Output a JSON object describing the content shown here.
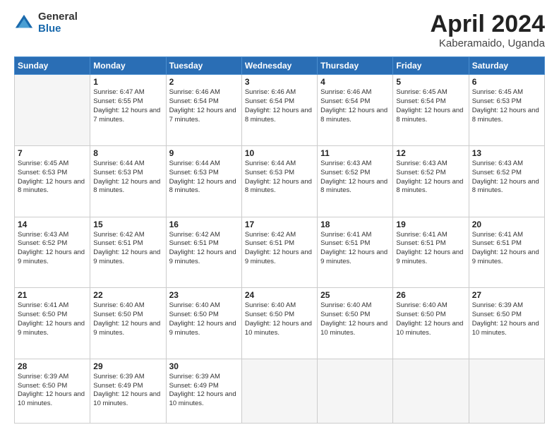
{
  "logo": {
    "general": "General",
    "blue": "Blue"
  },
  "title": {
    "month": "April 2024",
    "location": "Kaberamaido, Uganda"
  },
  "header_days": [
    "Sunday",
    "Monday",
    "Tuesday",
    "Wednesday",
    "Thursday",
    "Friday",
    "Saturday"
  ],
  "weeks": [
    [
      {
        "day": "",
        "sunrise": "",
        "sunset": "",
        "daylight": ""
      },
      {
        "day": "1",
        "sunrise": "Sunrise: 6:47 AM",
        "sunset": "Sunset: 6:55 PM",
        "daylight": "Daylight: 12 hours and 7 minutes."
      },
      {
        "day": "2",
        "sunrise": "Sunrise: 6:46 AM",
        "sunset": "Sunset: 6:54 PM",
        "daylight": "Daylight: 12 hours and 7 minutes."
      },
      {
        "day": "3",
        "sunrise": "Sunrise: 6:46 AM",
        "sunset": "Sunset: 6:54 PM",
        "daylight": "Daylight: 12 hours and 8 minutes."
      },
      {
        "day": "4",
        "sunrise": "Sunrise: 6:46 AM",
        "sunset": "Sunset: 6:54 PM",
        "daylight": "Daylight: 12 hours and 8 minutes."
      },
      {
        "day": "5",
        "sunrise": "Sunrise: 6:45 AM",
        "sunset": "Sunset: 6:54 PM",
        "daylight": "Daylight: 12 hours and 8 minutes."
      },
      {
        "day": "6",
        "sunrise": "Sunrise: 6:45 AM",
        "sunset": "Sunset: 6:53 PM",
        "daylight": "Daylight: 12 hours and 8 minutes."
      }
    ],
    [
      {
        "day": "7",
        "sunrise": "Sunrise: 6:45 AM",
        "sunset": "Sunset: 6:53 PM",
        "daylight": "Daylight: 12 hours and 8 minutes."
      },
      {
        "day": "8",
        "sunrise": "Sunrise: 6:44 AM",
        "sunset": "Sunset: 6:53 PM",
        "daylight": "Daylight: 12 hours and 8 minutes."
      },
      {
        "day": "9",
        "sunrise": "Sunrise: 6:44 AM",
        "sunset": "Sunset: 6:53 PM",
        "daylight": "Daylight: 12 hours and 8 minutes."
      },
      {
        "day": "10",
        "sunrise": "Sunrise: 6:44 AM",
        "sunset": "Sunset: 6:53 PM",
        "daylight": "Daylight: 12 hours and 8 minutes."
      },
      {
        "day": "11",
        "sunrise": "Sunrise: 6:43 AM",
        "sunset": "Sunset: 6:52 PM",
        "daylight": "Daylight: 12 hours and 8 minutes."
      },
      {
        "day": "12",
        "sunrise": "Sunrise: 6:43 AM",
        "sunset": "Sunset: 6:52 PM",
        "daylight": "Daylight: 12 hours and 8 minutes."
      },
      {
        "day": "13",
        "sunrise": "Sunrise: 6:43 AM",
        "sunset": "Sunset: 6:52 PM",
        "daylight": "Daylight: 12 hours and 8 minutes."
      }
    ],
    [
      {
        "day": "14",
        "sunrise": "Sunrise: 6:43 AM",
        "sunset": "Sunset: 6:52 PM",
        "daylight": "Daylight: 12 hours and 9 minutes."
      },
      {
        "day": "15",
        "sunrise": "Sunrise: 6:42 AM",
        "sunset": "Sunset: 6:51 PM",
        "daylight": "Daylight: 12 hours and 9 minutes."
      },
      {
        "day": "16",
        "sunrise": "Sunrise: 6:42 AM",
        "sunset": "Sunset: 6:51 PM",
        "daylight": "Daylight: 12 hours and 9 minutes."
      },
      {
        "day": "17",
        "sunrise": "Sunrise: 6:42 AM",
        "sunset": "Sunset: 6:51 PM",
        "daylight": "Daylight: 12 hours and 9 minutes."
      },
      {
        "day": "18",
        "sunrise": "Sunrise: 6:41 AM",
        "sunset": "Sunset: 6:51 PM",
        "daylight": "Daylight: 12 hours and 9 minutes."
      },
      {
        "day": "19",
        "sunrise": "Sunrise: 6:41 AM",
        "sunset": "Sunset: 6:51 PM",
        "daylight": "Daylight: 12 hours and 9 minutes."
      },
      {
        "day": "20",
        "sunrise": "Sunrise: 6:41 AM",
        "sunset": "Sunset: 6:51 PM",
        "daylight": "Daylight: 12 hours and 9 minutes."
      }
    ],
    [
      {
        "day": "21",
        "sunrise": "Sunrise: 6:41 AM",
        "sunset": "Sunset: 6:50 PM",
        "daylight": "Daylight: 12 hours and 9 minutes."
      },
      {
        "day": "22",
        "sunrise": "Sunrise: 6:40 AM",
        "sunset": "Sunset: 6:50 PM",
        "daylight": "Daylight: 12 hours and 9 minutes."
      },
      {
        "day": "23",
        "sunrise": "Sunrise: 6:40 AM",
        "sunset": "Sunset: 6:50 PM",
        "daylight": "Daylight: 12 hours and 9 minutes."
      },
      {
        "day": "24",
        "sunrise": "Sunrise: 6:40 AM",
        "sunset": "Sunset: 6:50 PM",
        "daylight": "Daylight: 12 hours and 10 minutes."
      },
      {
        "day": "25",
        "sunrise": "Sunrise: 6:40 AM",
        "sunset": "Sunset: 6:50 PM",
        "daylight": "Daylight: 12 hours and 10 minutes."
      },
      {
        "day": "26",
        "sunrise": "Sunrise: 6:40 AM",
        "sunset": "Sunset: 6:50 PM",
        "daylight": "Daylight: 12 hours and 10 minutes."
      },
      {
        "day": "27",
        "sunrise": "Sunrise: 6:39 AM",
        "sunset": "Sunset: 6:50 PM",
        "daylight": "Daylight: 12 hours and 10 minutes."
      }
    ],
    [
      {
        "day": "28",
        "sunrise": "Sunrise: 6:39 AM",
        "sunset": "Sunset: 6:50 PM",
        "daylight": "Daylight: 12 hours and 10 minutes."
      },
      {
        "day": "29",
        "sunrise": "Sunrise: 6:39 AM",
        "sunset": "Sunset: 6:49 PM",
        "daylight": "Daylight: 12 hours and 10 minutes."
      },
      {
        "day": "30",
        "sunrise": "Sunrise: 6:39 AM",
        "sunset": "Sunset: 6:49 PM",
        "daylight": "Daylight: 12 hours and 10 minutes."
      },
      {
        "day": "",
        "sunrise": "",
        "sunset": "",
        "daylight": ""
      },
      {
        "day": "",
        "sunrise": "",
        "sunset": "",
        "daylight": ""
      },
      {
        "day": "",
        "sunrise": "",
        "sunset": "",
        "daylight": ""
      },
      {
        "day": "",
        "sunrise": "",
        "sunset": "",
        "daylight": ""
      }
    ]
  ]
}
